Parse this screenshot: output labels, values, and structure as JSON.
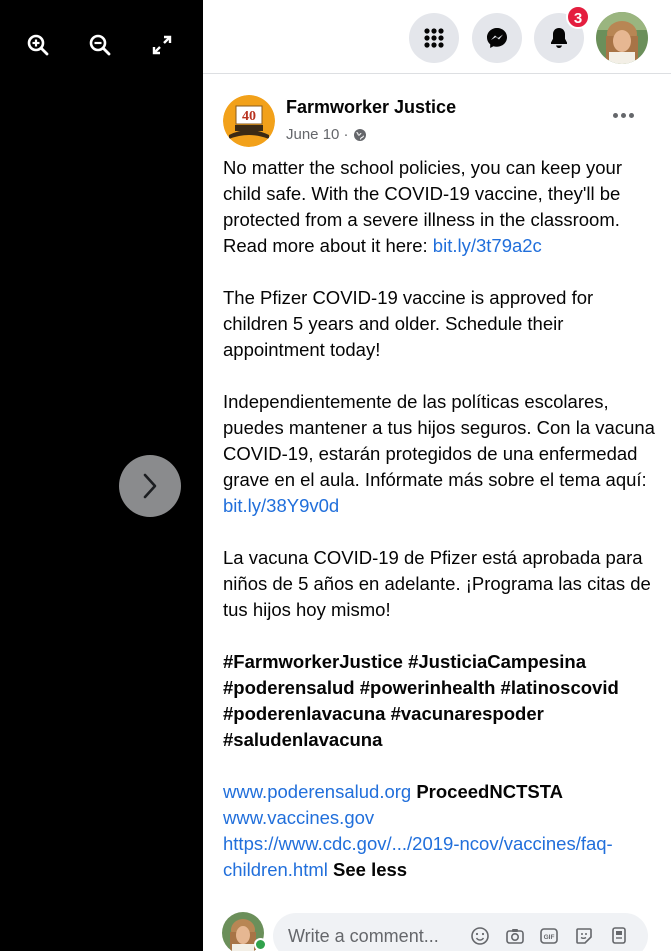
{
  "viewer": {
    "zoom_in_icon": "zoom-in-icon",
    "zoom_out_icon": "zoom-out-icon",
    "fullscreen_icon": "fullscreen-icon",
    "next_icon": "chevron-right-icon"
  },
  "topbar": {
    "menu_icon": "grid-menu-icon",
    "messenger_icon": "messenger-icon",
    "notifications_icon": "bell-icon",
    "notifications_count": "3"
  },
  "post": {
    "page_name": "Farmworker Justice",
    "date": "June 10 ·",
    "avatar_badge": "40",
    "paragraphs": {
      "p1_text": "No matter the school policies, you can keep your child safe. With the COVID-19 vaccine, they'll be protected from a severe illness in the classroom. Read more about it here: ",
      "p1_link": "bit.ly/3t79a2c",
      "p2_text": "The Pfizer COVID-19 vaccine is approved for children 5 years and older. Schedule their appointment today!",
      "p3_text": "Independientemente de las políticas escolares, puedes mantener a tus hijos seguros. Con la vacuna COVID-19, estarán protegidos de una enfermedad grave en el aula. Infórmate más sobre el tema aquí: ",
      "p3_link": "bit.ly/38Y9v0d",
      "p4_text": "La vacuna COVID-19 de Pfizer está aprobada para niños de 5 años en adelante. ¡Programa las citas de tus hijos hoy mismo!",
      "hashtags_line1": "#FarmworkerJustice #JusticiaCampesina",
      "hashtags_line2": "#poderensalud #powerinhealth #latinoscovid",
      "hashtags_line3": "#poderenlavacuna #vacunarespoder",
      "hashtags_line4": "#saludenlavacuna",
      "link_site": "www.poderensalud.org",
      "mention": "ProceedNCTSTA",
      "link_vaccines": "www.vaccines.gov",
      "link_cdc": "https://www.cdc.gov/.../2019-ncov/vaccines/faq-children.html",
      "see_less": "See less"
    }
  },
  "comment": {
    "placeholder": "Write a comment...",
    "icons": [
      "emoji-icon",
      "camera-icon",
      "gif-icon",
      "sticker-icon",
      "avatar-sticker-icon"
    ]
  },
  "colors": {
    "link": "#216fdb",
    "badge": "#e41e3f",
    "online": "#31a24c"
  }
}
